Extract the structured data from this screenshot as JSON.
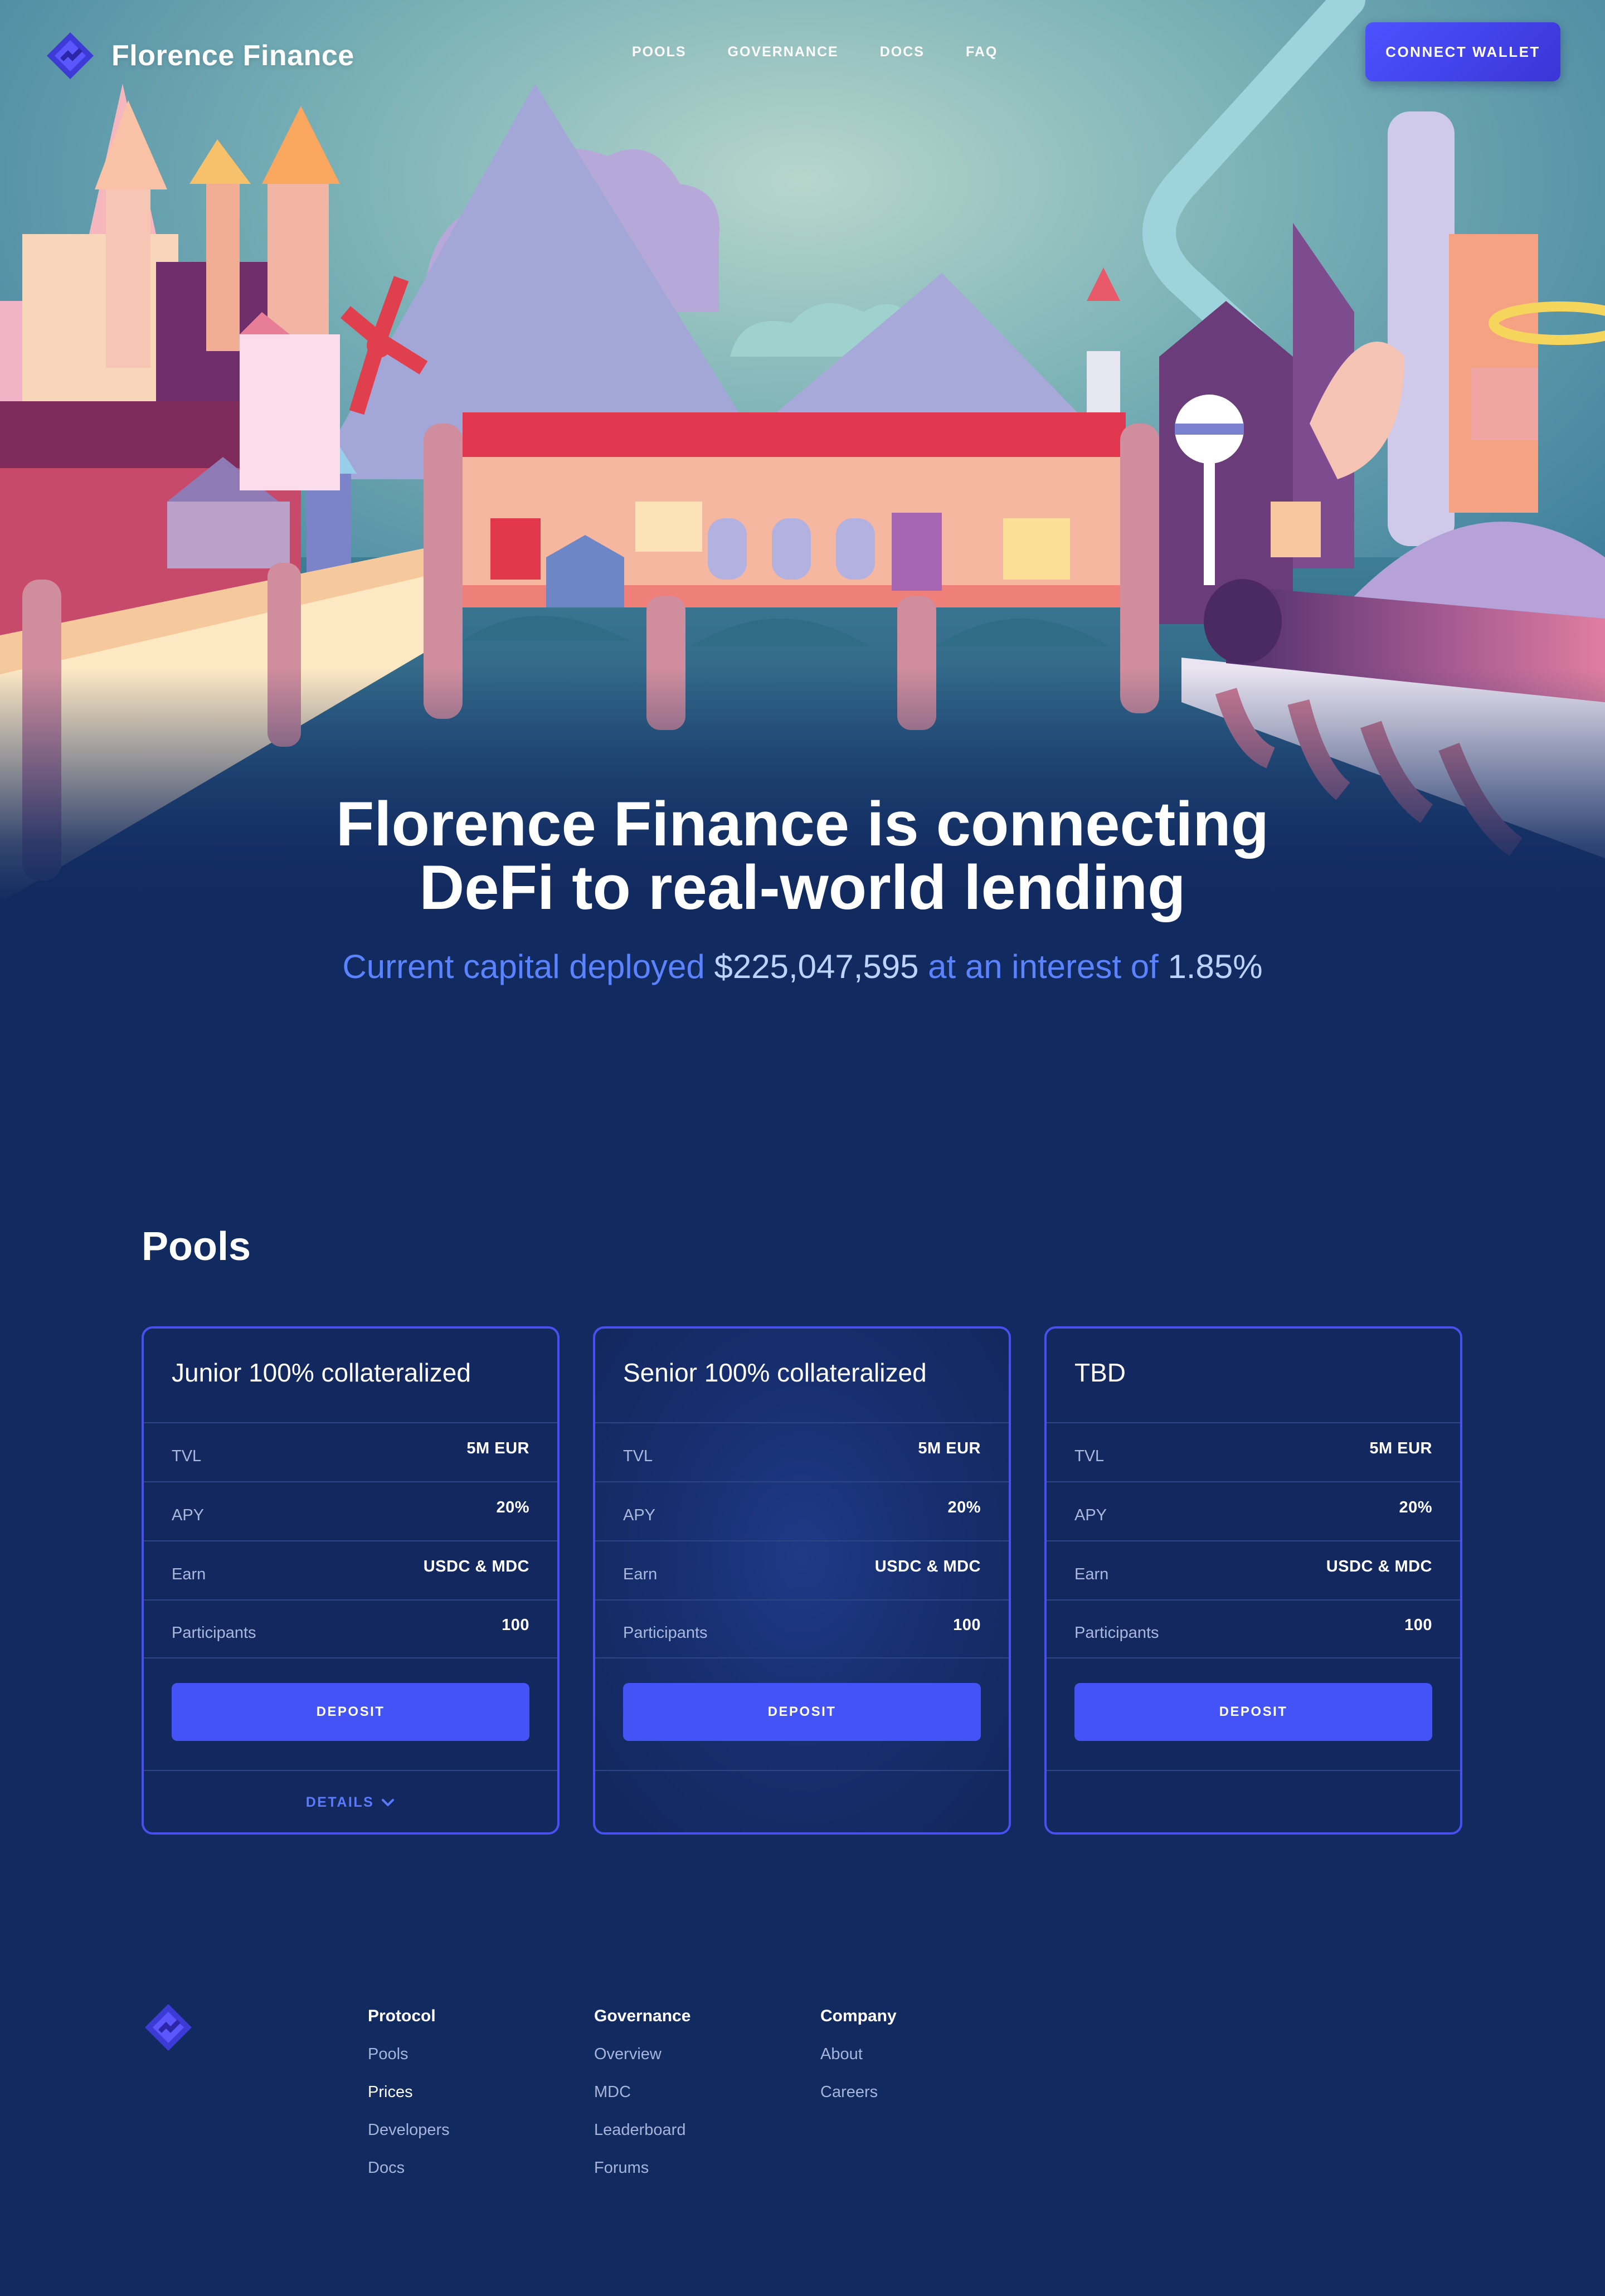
{
  "brand": {
    "name": "Florence Finance"
  },
  "nav": {
    "links": [
      "POOLS",
      "GOVERNANCE",
      "DOCS",
      "FAQ"
    ],
    "connect_wallet": "CONNECT WALLET"
  },
  "hero": {
    "headline_line1": "Florence Finance is connecting",
    "headline_line2": "DeFi to real-world lending",
    "capital_prefix": "Current capital deployed",
    "capital_value": "$225,047,595",
    "interest_prefix": "at an interest of",
    "interest_value": "1.85%"
  },
  "pools": {
    "title": "Pools",
    "cards": [
      {
        "title": "Junior 100% collateralized",
        "rows": [
          {
            "label": "TVL",
            "value": "5M EUR"
          },
          {
            "label": "APY",
            "value": "20%"
          },
          {
            "label": "Earn",
            "value": "USDC & MDC"
          },
          {
            "label": "Participants",
            "value": "100"
          }
        ],
        "deposit": "DEPOSIT",
        "details": "DETAILS"
      },
      {
        "title": "Senior 100% collateralized",
        "rows": [
          {
            "label": "TVL",
            "value": "5M EUR"
          },
          {
            "label": "APY",
            "value": "20%"
          },
          {
            "label": "Earn",
            "value": "USDC & MDC"
          },
          {
            "label": "Participants",
            "value": "100"
          }
        ],
        "deposit": "DEPOSIT"
      },
      {
        "title": "TBD",
        "rows": [
          {
            "label": "TVL",
            "value": "5M EUR"
          },
          {
            "label": "APY",
            "value": "20%"
          },
          {
            "label": "Earn",
            "value": "USDC & MDC"
          },
          {
            "label": "Participants",
            "value": "100"
          }
        ],
        "deposit": "DEPOSIT"
      }
    ]
  },
  "footer": {
    "columns": [
      {
        "heading": "Protocol",
        "links": [
          "Pools",
          "Prices",
          "Developers",
          "Docs"
        ]
      },
      {
        "heading": "Governance",
        "links": [
          "Overview",
          "MDC",
          "Leaderboard",
          "Forums"
        ]
      },
      {
        "heading": "Company",
        "links": [
          "About",
          "Careers"
        ]
      }
    ]
  },
  "colors": {
    "background": "#112a60",
    "accent": "#4353f6",
    "card_border": "#4751ef",
    "capital_text": "#5b83ff",
    "value_text": "#bcd3ff"
  },
  "icons": [
    "florence-logo-icon",
    "chevron-down-icon"
  ]
}
